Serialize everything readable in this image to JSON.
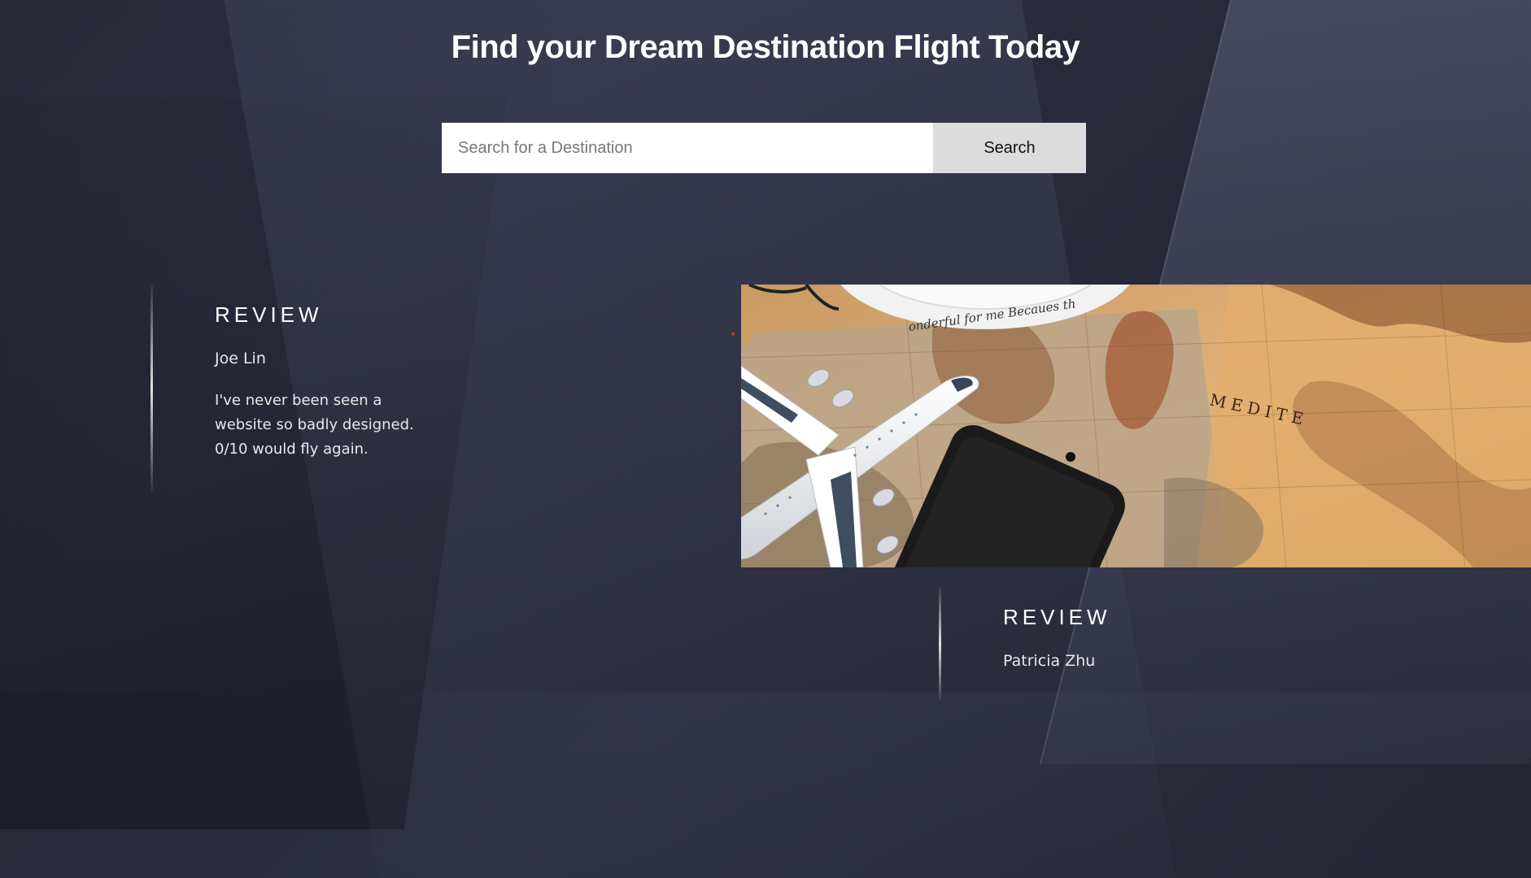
{
  "hero": {
    "title": "Find your Dream Destination Flight Today"
  },
  "search": {
    "placeholder": "Search for a Destination",
    "value": "",
    "button_label": "Search"
  },
  "reviews": [
    {
      "heading": "REVIEW",
      "author": "Joe Lin",
      "text": "I've never been seen a website so badly designed. 0/10 would fly again."
    },
    {
      "heading": "REVIEW",
      "author": "Patricia Zhu"
    }
  ],
  "photo": {
    "plate_text": "onderful for me Becaues th",
    "map_label": "MEDITE"
  },
  "colors": {
    "background": "#2a2c3e",
    "search_button": "#dcdcdc",
    "map": "#d7a86a",
    "accent_dot": "#c0392b"
  }
}
